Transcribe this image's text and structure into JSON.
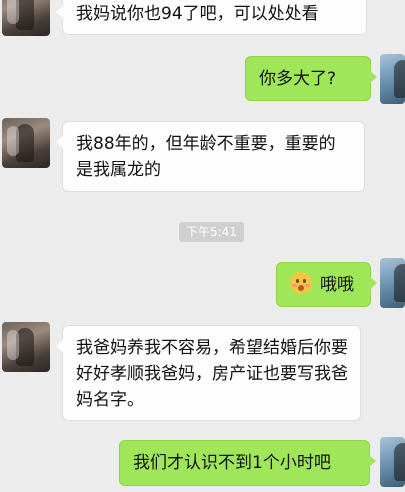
{
  "messages": [
    {
      "side": "left",
      "text": "我妈说你也94了吧，可以处处看"
    },
    {
      "side": "right",
      "text": "你多大了?"
    },
    {
      "side": "left",
      "text": "我88年的，但年龄不重要，重要的是我属龙的"
    },
    {
      "side": "right",
      "text": "哦哦",
      "emoji": "astonished-face"
    },
    {
      "side": "left",
      "text": "我爸妈养我不容易，希望结婚后你要好好孝顺我爸妈，房产证也要写我爸妈名字。"
    },
    {
      "side": "right",
      "text": "我们才认识不到1个小时吧"
    }
  ],
  "timestamp": "下午5:41",
  "colors": {
    "sent_bubble": "#9fe658",
    "received_bubble": "#fdfdfd",
    "background": "#ececec"
  }
}
